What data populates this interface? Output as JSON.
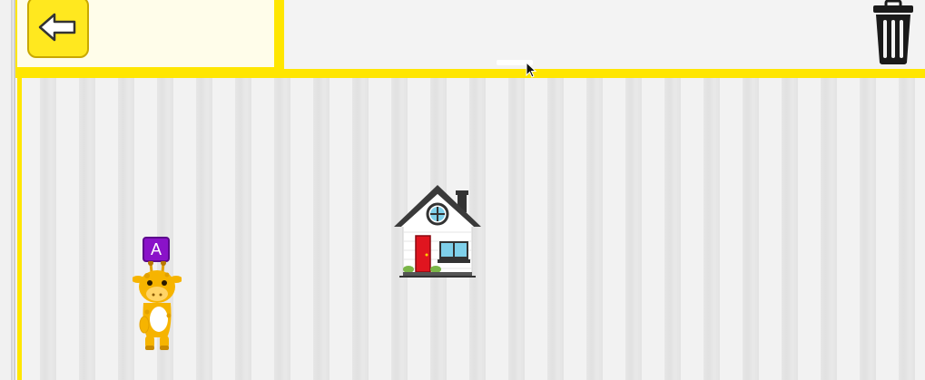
{
  "toolbar": {
    "back_icon": "arrow-left-icon",
    "trash_icon": "trash-icon"
  },
  "stage": {
    "background": "birch-tree-trunks",
    "sprites": [
      {
        "name": "house",
        "icon": "house-icon"
      },
      {
        "name": "giraffe",
        "icon": "giraffe-icon",
        "label": "A"
      }
    ]
  },
  "colors": {
    "accent_yellow": "#ffe600",
    "panel_cream": "#fffdea",
    "badge_purple": "#8a12c9",
    "door_red": "#e0151f"
  }
}
